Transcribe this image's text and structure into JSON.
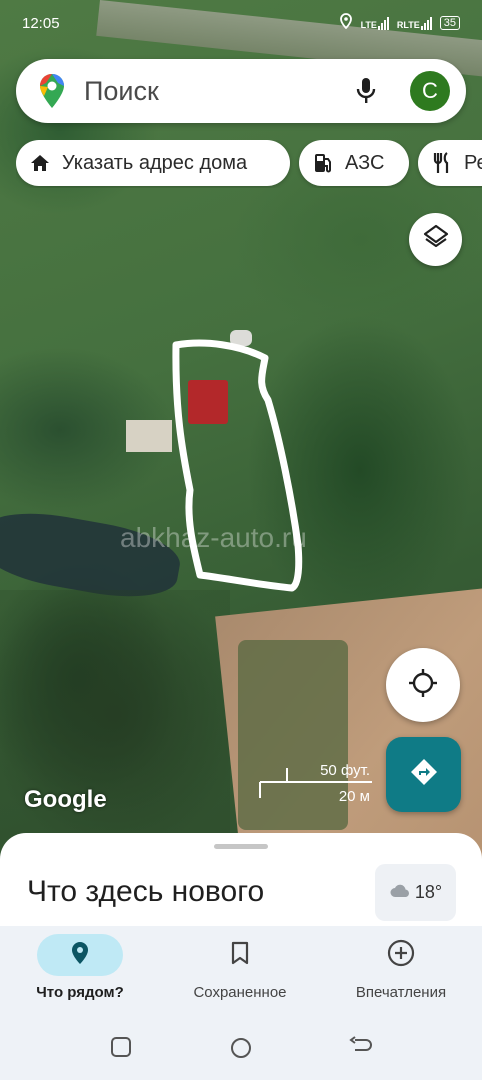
{
  "status_bar": {
    "time": "12:05",
    "signal1": "LTE",
    "signal2": "RLTE",
    "battery": "35"
  },
  "map": {
    "watermark": "abkhaz-auto.ru",
    "google_logo": "Google",
    "scale_ft": "50 фут.",
    "scale_m": "20 м"
  },
  "search": {
    "placeholder": "Поиск",
    "avatar_letter": "C"
  },
  "chips": [
    {
      "label": "Указать адрес дома",
      "icon": "home-icon"
    },
    {
      "label": "АЗС",
      "icon": "gas-station-icon"
    },
    {
      "label": "Ре",
      "icon": "restaurant-icon"
    }
  ],
  "sheet": {
    "title": "Что здесь нового",
    "weather_temp": "18°",
    "weather_icon": "cloud-icon"
  },
  "bottom_nav": [
    {
      "label": "Что рядом?",
      "icon": "location-pin-icon",
      "active": true
    },
    {
      "label": "Сохраненное",
      "icon": "bookmark-icon",
      "active": false
    },
    {
      "label": "Впечатления",
      "icon": "add-circle-icon",
      "active": false
    }
  ],
  "colors": {
    "accent": "#0f7b86",
    "avatar": "#2e7a1f",
    "nav_active": "#bfe9f5"
  }
}
